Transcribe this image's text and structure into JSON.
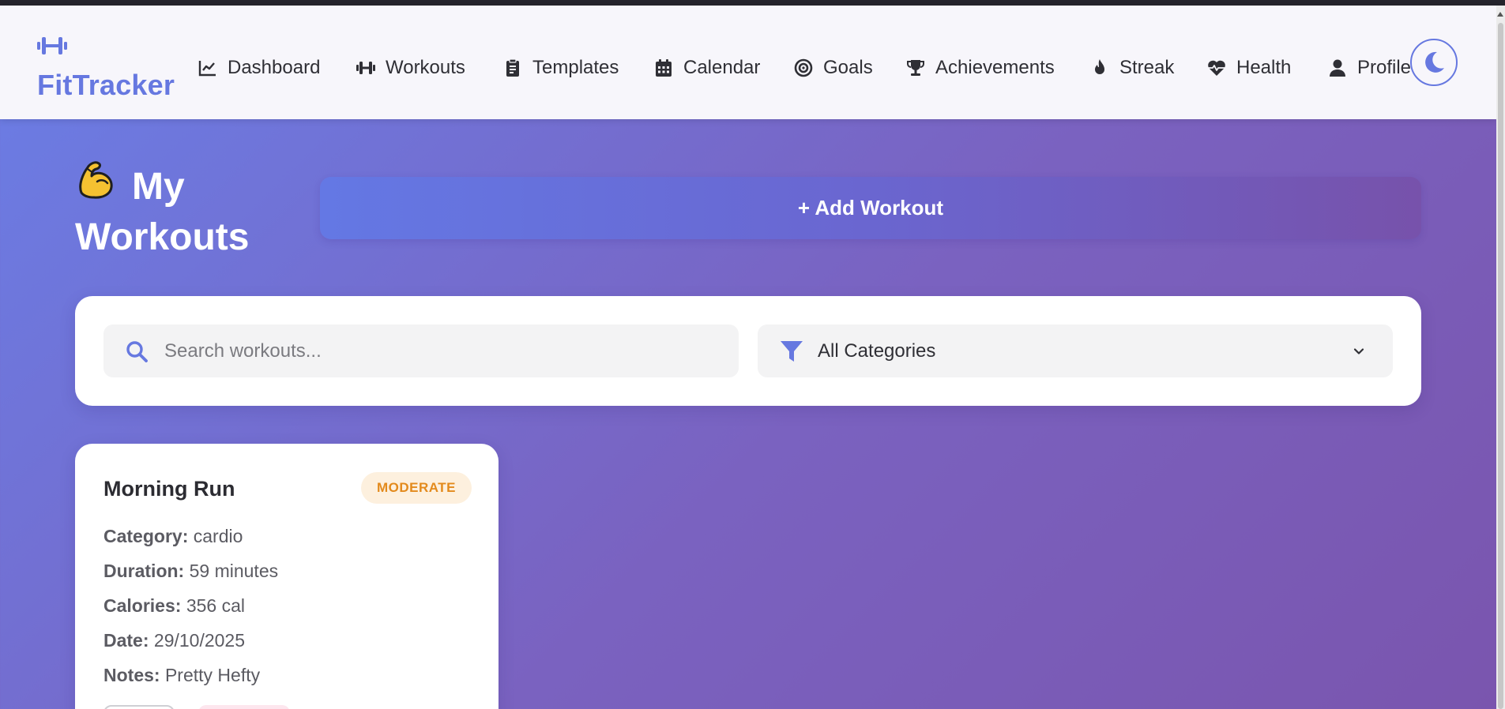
{
  "app": {
    "brand": "FitTracker",
    "brand_color": "#6678e0",
    "brand_icon": "dumbbell-icon"
  },
  "nav": {
    "items": [
      {
        "label": "Dashboard",
        "icon": "chart-line-icon"
      },
      {
        "label": "Workouts",
        "icon": "dumbbell-icon"
      },
      {
        "label": "Templates",
        "icon": "clipboard-icon"
      },
      {
        "label": "Calendar",
        "icon": "calendar-icon"
      },
      {
        "label": "Goals",
        "icon": "target-icon"
      },
      {
        "label": "Achievements",
        "icon": "trophy-icon"
      },
      {
        "label": "Streak",
        "icon": "fire-icon"
      },
      {
        "label": "Health",
        "icon": "heart-pulse-icon"
      },
      {
        "label": "Profile",
        "icon": "user-icon"
      }
    ],
    "theme_toggle_icon": "moon-icon"
  },
  "header": {
    "emoji": "flexed-biceps-icon",
    "title": "My Workouts",
    "add_button": "+ Add Workout"
  },
  "filters": {
    "search_placeholder": "Search workouts...",
    "search_value": "",
    "category_selected": "All Categories"
  },
  "workouts": [
    {
      "title": "Morning Run",
      "intensity": "MODERATE",
      "intensity_color": "#e38a1c",
      "details": [
        {
          "label": "Category:",
          "value": "cardio"
        },
        {
          "label": "Duration:",
          "value": "59 minutes"
        },
        {
          "label": "Calories:",
          "value": "356 cal"
        },
        {
          "label": "Date:",
          "value": "29/10/2025"
        },
        {
          "label": "Notes:",
          "value": "Pretty Hefty"
        }
      ]
    }
  ]
}
